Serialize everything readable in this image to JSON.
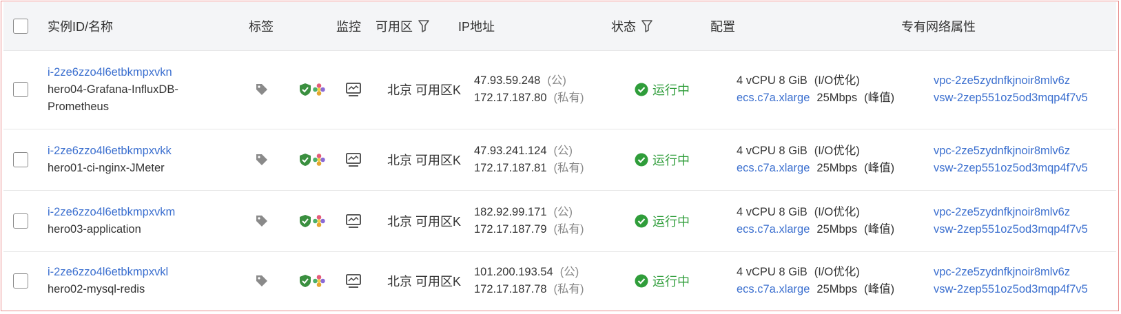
{
  "header": {
    "instance": "实例ID/名称",
    "tags": "标签",
    "monitor": "监控",
    "zone": "可用区",
    "ip": "IP地址",
    "status": "状态",
    "config": "配置",
    "vpc": "专有网络属性"
  },
  "rows": [
    {
      "id": "i-2ze6zzo4l6etbkmpxvkn",
      "name1": "hero04-Grafana-InfluxDB-",
      "name2": "Prometheus",
      "zone": "北京 可用区K",
      "ip_public": "47.93.59.248",
      "ip_public_tag": "(公)",
      "ip_private": "172.17.187.80",
      "ip_private_tag": "(私有)",
      "status": "运行中",
      "spec": "4 vCPU 8 GiB",
      "spec_tag": "(I/O优化)",
      "instance_type": "ecs.c7a.xlarge",
      "bandwidth": "25Mbps",
      "bandwidth_tag": "(峰值)",
      "vpc": "vpc-2ze5zydnfkjnoir8mlv6z",
      "vsw": "vsw-2zep551oz5od3mqp4f7v5"
    },
    {
      "id": "i-2ze6zzo4l6etbkmpxvkk",
      "name1": "hero01-ci-nginx-JMeter",
      "name2": "",
      "zone": "北京 可用区K",
      "ip_public": "47.93.241.124",
      "ip_public_tag": "(公)",
      "ip_private": "172.17.187.81",
      "ip_private_tag": "(私有)",
      "status": "运行中",
      "spec": "4 vCPU 8 GiB",
      "spec_tag": "(I/O优化)",
      "instance_type": "ecs.c7a.xlarge",
      "bandwidth": "25Mbps",
      "bandwidth_tag": "(峰值)",
      "vpc": "vpc-2ze5zydnfkjnoir8mlv6z",
      "vsw": "vsw-2zep551oz5od3mqp4f7v5"
    },
    {
      "id": "i-2ze6zzo4l6etbkmpxvkm",
      "name1": "hero03-application",
      "name2": "",
      "zone": "北京 可用区K",
      "ip_public": "182.92.99.171",
      "ip_public_tag": "(公)",
      "ip_private": "172.17.187.79",
      "ip_private_tag": "(私有)",
      "status": "运行中",
      "spec": "4 vCPU 8 GiB",
      "spec_tag": "(I/O优化)",
      "instance_type": "ecs.c7a.xlarge",
      "bandwidth": "25Mbps",
      "bandwidth_tag": "(峰值)",
      "vpc": "vpc-2ze5zydnfkjnoir8mlv6z",
      "vsw": "vsw-2zep551oz5od3mqp4f7v5"
    },
    {
      "id": "i-2ze6zzo4l6etbkmpxvkl",
      "name1": "hero02-mysql-redis",
      "name2": "",
      "zone": "北京 可用区K",
      "ip_public": "101.200.193.54",
      "ip_public_tag": "(公)",
      "ip_private": "172.17.187.78",
      "ip_private_tag": "(私有)",
      "status": "运行中",
      "spec": "4 vCPU 8 GiB",
      "spec_tag": "(I/O优化)",
      "instance_type": "ecs.c7a.xlarge",
      "bandwidth": "25Mbps",
      "bandwidth_tag": "(峰值)",
      "vpc": "vpc-2ze5zydnfkjnoir8mlv6z",
      "vsw": "vsw-2zep551oz5od3mqp4f7v5"
    }
  ],
  "icons": {
    "tag": "tag-icon",
    "security": "shield-icon",
    "plugin": "flower-icon",
    "monitor": "monitor-icon",
    "filter": "filter-icon",
    "running": "check-circle-icon"
  },
  "colors": {
    "link": "#3b6fcf",
    "running": "#2f9d3a",
    "header_bg": "#f4f5f7",
    "frame_border": "#e88a8a"
  }
}
